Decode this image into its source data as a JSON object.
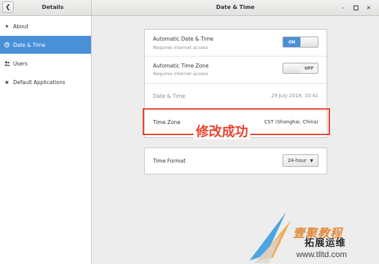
{
  "header": {
    "left_title": "Details",
    "title": "Date & Time",
    "back_icon": "chevron-left-icon",
    "controls": [
      "minimize",
      "maximize",
      "close"
    ]
  },
  "sidebar": {
    "items": [
      {
        "label": "About",
        "icon": "about-icon",
        "active": false
      },
      {
        "label": "Date & Time",
        "icon": "clock-icon",
        "active": true
      },
      {
        "label": "Users",
        "icon": "users-icon",
        "active": false
      },
      {
        "label": "Default Applications",
        "icon": "star-icon",
        "active": false
      }
    ]
  },
  "settings": {
    "auto_datetime": {
      "title": "Automatic Date & Time",
      "subtitle": "Requires internet access",
      "state": "ON"
    },
    "auto_timezone": {
      "title": "Automatic Time Zone",
      "subtitle": "Requires internet access",
      "state": "OFF"
    },
    "datetime": {
      "label": "Date & Time",
      "value": "29 July 2018, 10:41"
    },
    "timezone": {
      "label": "Time Zone",
      "value": "CST (Shanghai, China)"
    },
    "time_format": {
      "label": "Time Format",
      "value": "24-hour"
    }
  },
  "annotation": {
    "text": "修改成功",
    "color": "#e8432f"
  },
  "watermark": {
    "line1": "壹聚教程",
    "line2": "拓展运维",
    "url": "www.tlltd.com"
  },
  "colors": {
    "accent": "#4a90d9",
    "annotation": "#e8432f"
  }
}
